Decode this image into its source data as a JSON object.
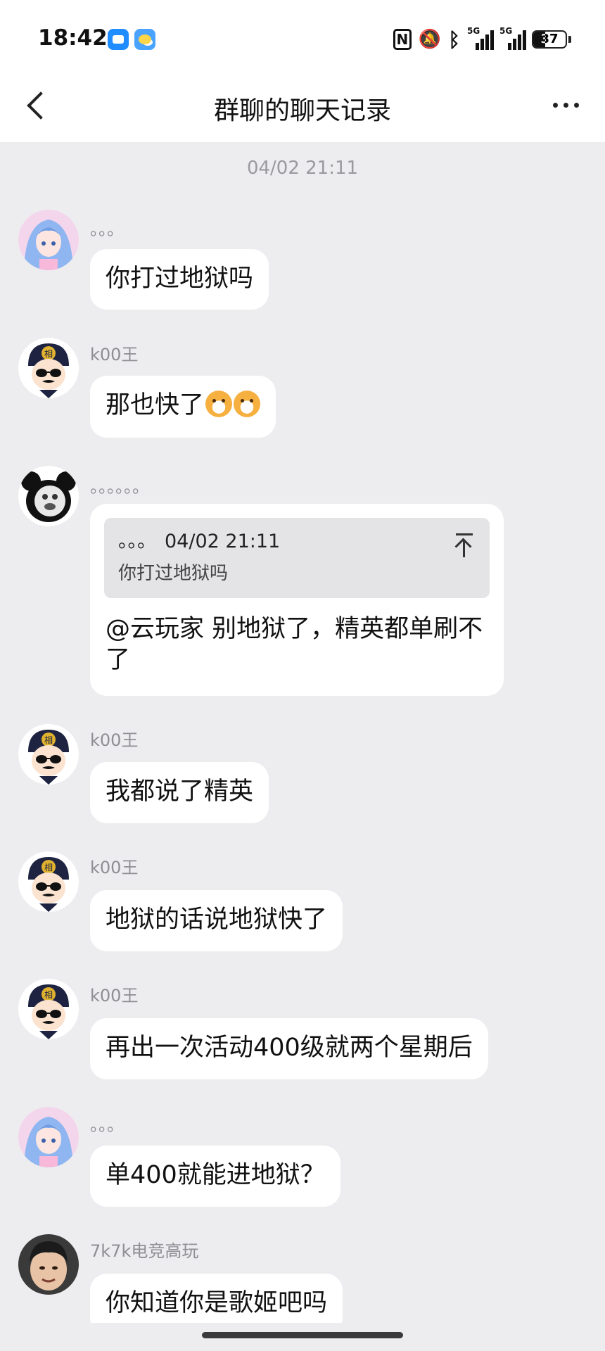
{
  "status_bar": {
    "time": "18:42",
    "network_1": "5G",
    "network_2": "5G",
    "battery_level": 37,
    "battery_text": "37",
    "nfc_label": "N"
  },
  "nav": {
    "title": "群聊的聊天记录"
  },
  "timestamp": "04/02 21:11",
  "messages": [
    {
      "sender": "。。。",
      "text": "你打过地狱吗",
      "avatar": "anime-girl-avatar"
    },
    {
      "sender": "k00王",
      "text": "那也快了",
      "avatar": "general-cartoon-avatar",
      "emoji_count": 2
    },
    {
      "sender": "。。。。。。",
      "avatar": "panda-meme-avatar",
      "quote": {
        "author": "。。。",
        "time": "04/02 21:11",
        "text": "你打过地狱吗"
      },
      "text": "@云玩家 别地狱了，精英都单刷不了"
    },
    {
      "sender": "k00王",
      "text": "我都说了精英",
      "avatar": "general-cartoon-avatar"
    },
    {
      "sender": "k00王",
      "text": "地狱的话说地狱快了",
      "avatar": "general-cartoon-avatar"
    },
    {
      "sender": "k00王",
      "text": "再出一次活动400级就两个星期后",
      "avatar": "general-cartoon-avatar"
    },
    {
      "sender": "。。。",
      "text": "单400就能进地狱？",
      "avatar": "anime-girl-avatar"
    },
    {
      "sender": "7k7k电竞高玩",
      "text": "你知道你是歌姬吧吗",
      "avatar": "photo-avatar"
    }
  ],
  "colors": {
    "background": "#ededf0",
    "bubble": "#ffffff",
    "sender_text": "#8e8e93"
  }
}
